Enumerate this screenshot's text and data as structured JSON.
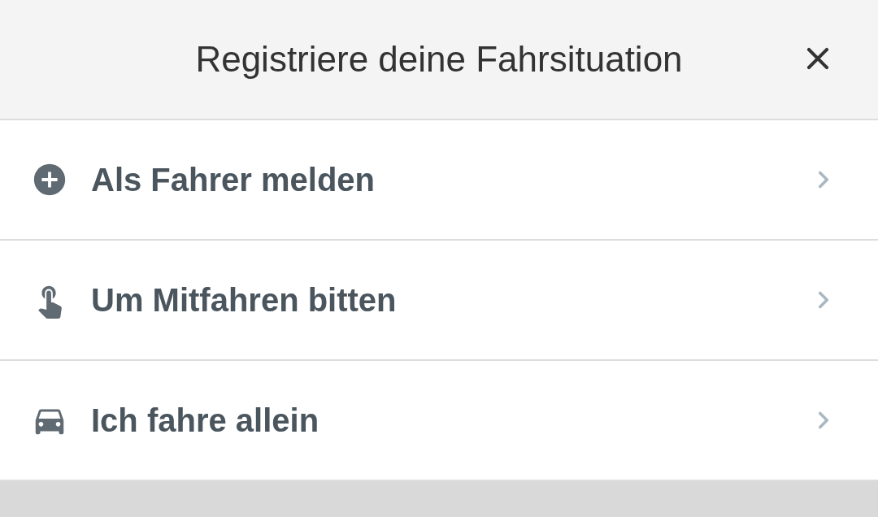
{
  "header": {
    "title": "Registriere deine Fahrsituation"
  },
  "options": [
    {
      "kind": "add",
      "label": "Als Fahrer melden"
    },
    {
      "kind": "touch",
      "label": "Um Mitfahren bitten"
    },
    {
      "kind": "car",
      "label": "Ich fahre allein"
    }
  ]
}
